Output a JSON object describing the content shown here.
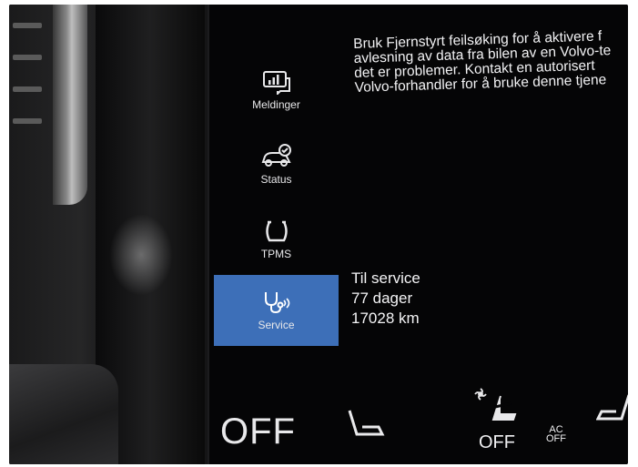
{
  "sidebar": {
    "items": [
      {
        "label": "Meldinger",
        "icon": "messages-icon"
      },
      {
        "label": "Status",
        "icon": "car-status-icon"
      },
      {
        "label": "TPMS",
        "icon": "tire-pressure-icon"
      },
      {
        "label": "Service",
        "icon": "stethoscope-icon",
        "active": true
      }
    ]
  },
  "info": {
    "lines": [
      "Bruk Fjernstyrt feilsøking for å aktivere f",
      "avlesning av data fra bilen av en Volvo-te",
      "det er problemer. Kontakt en autorisert",
      "Volvo-forhandler for å bruke denne tjene"
    ]
  },
  "service": {
    "title": "Til service",
    "days": "77 dager",
    "distance": "17028 km"
  },
  "climate": {
    "fan_off": "OFF",
    "seat_off": "OFF",
    "ac_label": "AC",
    "ac_off": "OFF"
  },
  "colors": {
    "active_tab": "#3d6fb8",
    "screen_bg": "#050506",
    "text": "#f2f2f4"
  }
}
